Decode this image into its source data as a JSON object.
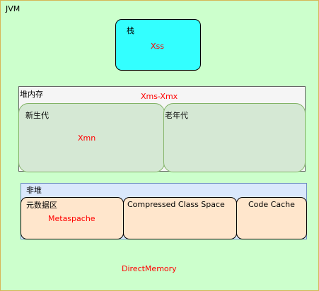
{
  "outer": {
    "label": "JVM"
  },
  "stack": {
    "label": "栈",
    "param": "Xss"
  },
  "heap": {
    "label": "堆内存",
    "param": "Xms-Xmx"
  },
  "young_gen": {
    "label": "新生代",
    "param": "Xmn"
  },
  "old_gen": {
    "label": "老年代"
  },
  "non_heap": {
    "label": "非堆"
  },
  "metaspace": {
    "label": "元数据区",
    "param": "Metaspache"
  },
  "compressed_class_space": {
    "label": "Compressed Class Space"
  },
  "code_cache": {
    "label": "Code Cache"
  },
  "direct_memory": {
    "label": "DirectMemory"
  },
  "colors": {
    "background": "#ccffcc",
    "stack_fill": "#33ffff",
    "heap_fill": "#f5f5f5",
    "generation_fill": "#d5e8d4",
    "non_heap_fill": "#dae8fc",
    "non_heap_part_fill": "#ffe6cc",
    "param_text": "#ff0000"
  }
}
